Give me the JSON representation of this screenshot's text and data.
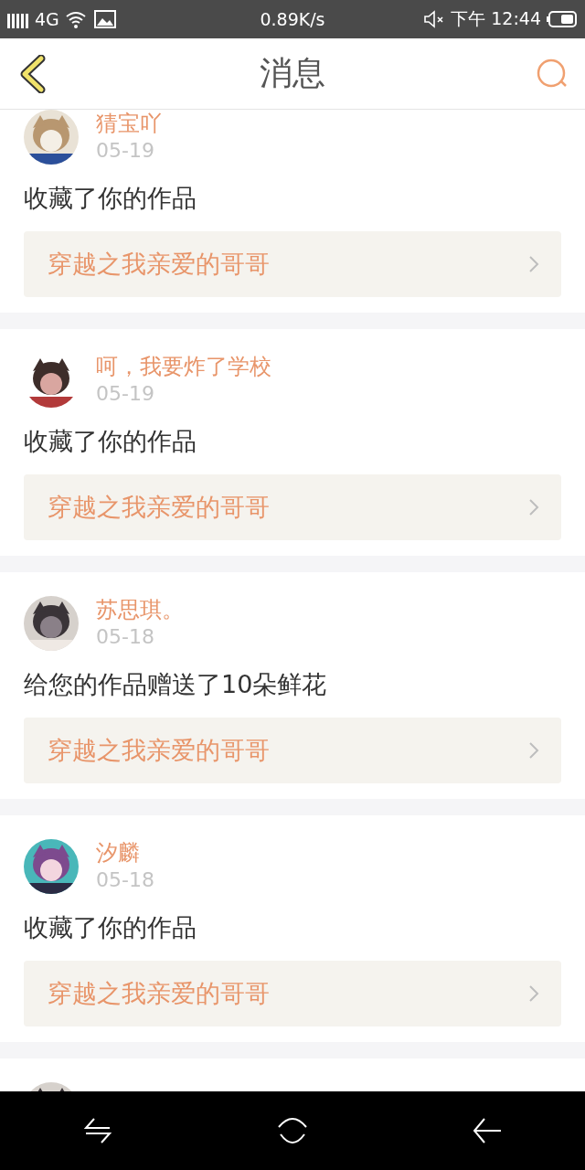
{
  "status_bar": {
    "network": "4G",
    "speed": "0.89K/s",
    "time": "下午 12:44"
  },
  "header": {
    "title": "消息"
  },
  "messages": [
    {
      "name": "猜宝吖",
      "date": "05-19",
      "action": "收藏了你的作品",
      "work": "穿越之我亲爱的哥哥",
      "avatar": {
        "kind": "picture"
      }
    },
    {
      "name": "呵，我要炸了学校",
      "date": "05-19",
      "action": "收藏了你的作品",
      "work": "穿越之我亲爱的哥哥",
      "avatar": {
        "kind": "picture"
      }
    },
    {
      "name": "苏思琪。",
      "date": "05-18",
      "action": "给您的作品赠送了10朵鲜花",
      "work": "穿越之我亲爱的哥哥",
      "avatar": {
        "kind": "picture"
      }
    },
    {
      "name": "汐麟",
      "date": "05-18",
      "action": "收藏了你的作品",
      "work": "穿越之我亲爱的哥哥",
      "avatar": {
        "kind": "picture"
      }
    },
    {
      "avatar": {
        "kind": "picture"
      }
    }
  ]
}
